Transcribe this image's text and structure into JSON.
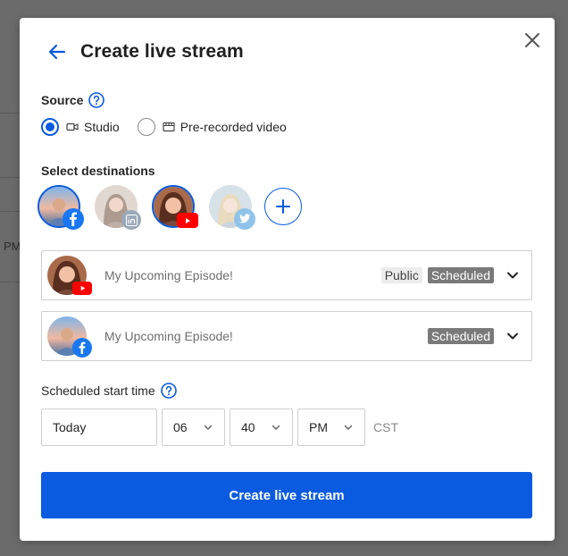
{
  "background": {
    "partial_text": "PM"
  },
  "modal": {
    "title": "Create live stream",
    "source": {
      "label": "Source",
      "options": [
        {
          "label": "Studio",
          "icon": "camera-icon",
          "selected": true
        },
        {
          "label": "Pre-recorded video",
          "icon": "clapperboard-icon",
          "selected": false
        }
      ]
    },
    "destinations": {
      "label": "Select destinations",
      "items": [
        {
          "platform": "facebook",
          "selected": true
        },
        {
          "platform": "linkedin",
          "selected": false
        },
        {
          "platform": "youtube",
          "selected": true
        },
        {
          "platform": "twitter",
          "selected": false
        }
      ]
    },
    "episodes": [
      {
        "title": "My Upcoming Episode!",
        "platform": "youtube",
        "tags": [
          "Public",
          "Scheduled"
        ]
      },
      {
        "title": "My Upcoming Episode!",
        "platform": "facebook",
        "tags": [
          "Scheduled"
        ]
      }
    ],
    "schedule": {
      "label": "Scheduled start time",
      "date": "Today",
      "hour": "06",
      "minute": "40",
      "period": "PM",
      "timezone": "CST"
    },
    "submit_label": "Create live stream"
  },
  "colors": {
    "primary": "#0a5be0",
    "facebook": "#1877f2",
    "youtube": "#ff0000",
    "linkedin": "#0a66c2",
    "twitter": "#1da1f2"
  }
}
